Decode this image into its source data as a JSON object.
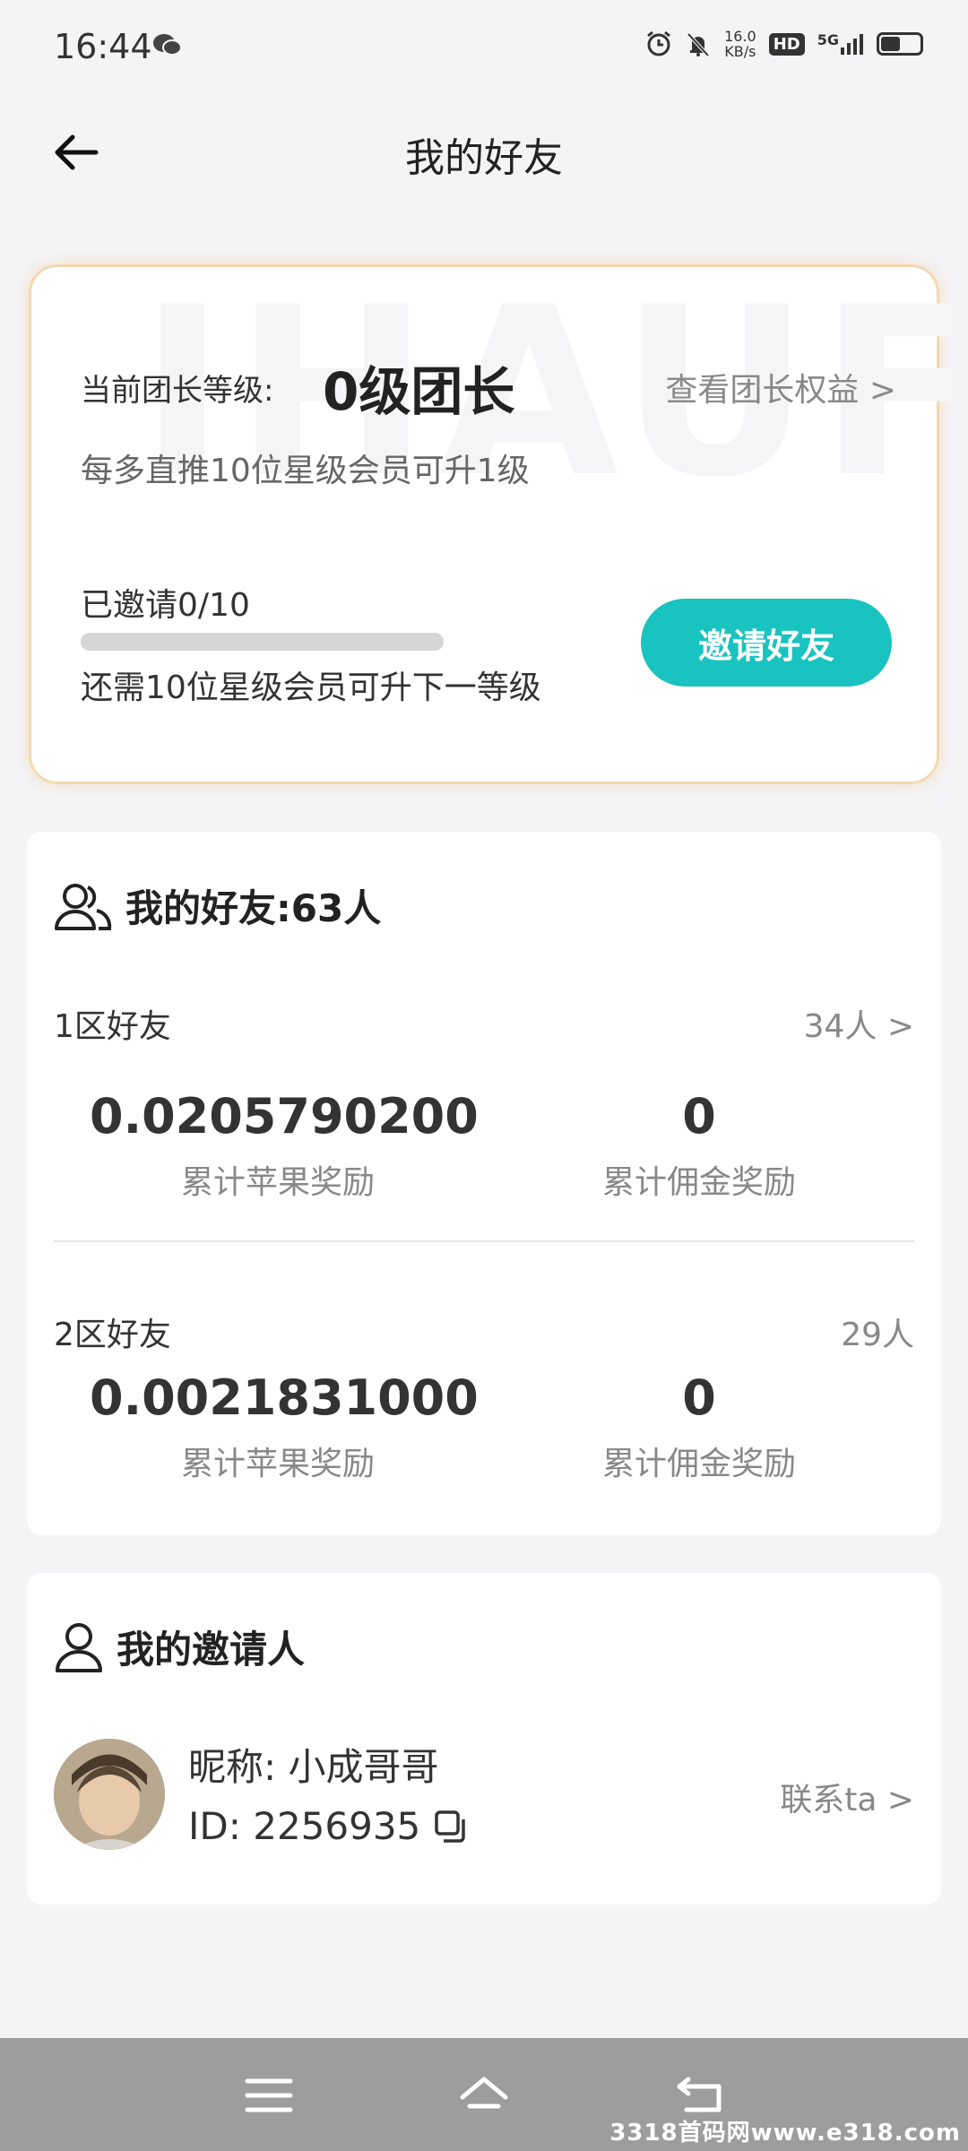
{
  "status_bar": {
    "time": "16:44",
    "net_speed_value": "16.0",
    "net_speed_unit": "KB/s",
    "hd_badge": "HD",
    "network": "5G",
    "battery_level": 0.55
  },
  "header": {
    "title": "我的好友"
  },
  "level_card": {
    "watermark": "IHAUF",
    "level_label": "当前团长等级:",
    "level_value": "0级团长",
    "benefit_link": "查看团长权益 >",
    "level_hint": "每多直推10位星级会员可升1级",
    "invited_text": "已邀请0/10",
    "invited_progress": 0,
    "next_level_hint": "还需10位星级会员可升下一等级",
    "invite_button": "邀请好友"
  },
  "friends": {
    "title": "我的好友:63人",
    "zones": [
      {
        "label": "1区好友",
        "count": "34人 >",
        "apple_reward": "0.0205790200",
        "apple_reward_label": "累计苹果奖励",
        "commission_reward": "0",
        "commission_reward_label": "累计佣金奖励"
      },
      {
        "label": "2区好友",
        "count": "29人",
        "apple_reward": "0.0021831000",
        "apple_reward_label": "累计苹果奖励",
        "commission_reward": "0",
        "commission_reward_label": "累计佣金奖励"
      }
    ]
  },
  "inviter": {
    "title": "我的邀请人",
    "nickname": "昵称: 小成哥哥",
    "id": "ID: 2256935",
    "contact": "联系ta >"
  },
  "watermark_site": "3318首码网www.e318.com",
  "colors": {
    "accent": "#19c3c0",
    "card_border": "#f3d9b0",
    "background": "#f4f4f7"
  }
}
